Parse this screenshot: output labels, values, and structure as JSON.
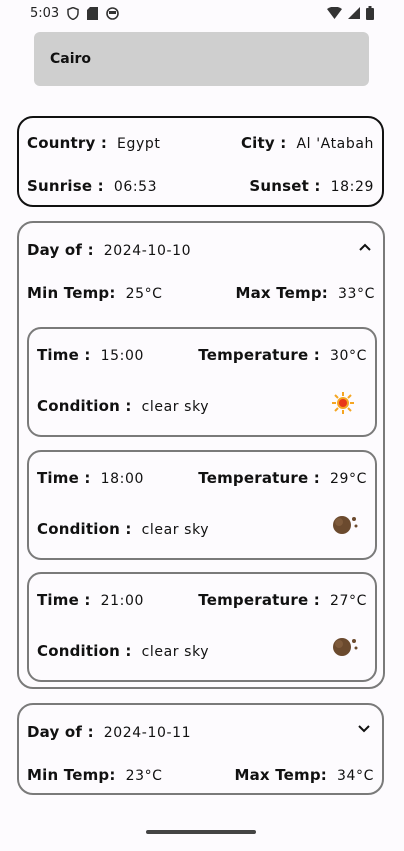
{
  "status": {
    "time": "5:03",
    "icons": [
      "shield-icon",
      "sd-card-icon",
      "face-icon",
      "wifi-icon",
      "signal-icon",
      "battery-icon"
    ]
  },
  "search": {
    "value": "Cairo"
  },
  "location": {
    "country_label": "Country :",
    "country": "Egypt",
    "city_label": "City :",
    "city": "Al 'Atabah",
    "sunrise_label": "Sunrise :",
    "sunrise": "06:53",
    "sunset_label": "Sunset :",
    "sunset": "18:29"
  },
  "days": [
    {
      "day_label": "Day of :",
      "date": "2024-10-10",
      "min_label": "Min Temp:",
      "min": "25°C",
      "max_label": "Max Temp:",
      "max": "33°C",
      "expanded": true,
      "hours": [
        {
          "time_label": "Time :",
          "time": "15:00",
          "temp_label": "Temperature :",
          "temp": "30°C",
          "cond_label": "Condition :",
          "condition": "clear sky",
          "icon": "sun-icon"
        },
        {
          "time_label": "Time :",
          "time": "18:00",
          "temp_label": "Temperature :",
          "temp": "29°C",
          "cond_label": "Condition :",
          "condition": "clear sky",
          "icon": "moon-icon"
        },
        {
          "time_label": "Time :",
          "time": "21:00",
          "temp_label": "Temperature :",
          "temp": "27°C",
          "cond_label": "Condition :",
          "condition": "clear sky",
          "icon": "moon-icon"
        }
      ]
    },
    {
      "day_label": "Day of :",
      "date": "2024-10-11",
      "min_label": "Min Temp:",
      "min": "23°C",
      "max_label": "Max Temp:",
      "max": "34°C",
      "expanded": false
    }
  ],
  "colors": {
    "sun": "#f5a623",
    "sun_core": "#e8381a",
    "moon": "#6b4a2e",
    "card_border": "#7a7a7a",
    "search_bg": "#cfcfcf"
  }
}
